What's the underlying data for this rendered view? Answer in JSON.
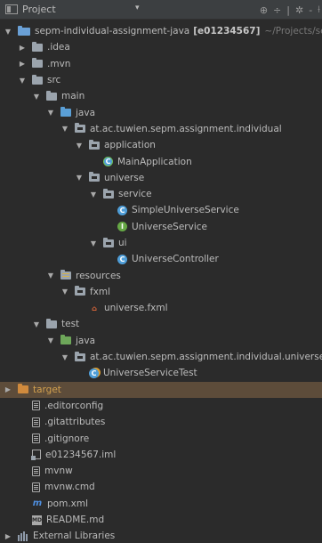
{
  "header": {
    "title": "Project",
    "dropdown": "▾",
    "tools": [
      "⊕",
      "÷",
      "|",
      "✲",
      "-",
      "⟊"
    ]
  },
  "tree": [
    {
      "depth": 0,
      "arrow": "▼",
      "icon": "module",
      "label": "sepm-individual-assignment-java",
      "bold_label": "[e01234567]",
      "path": "~/Projects/sepm",
      "name": "tree-item-root"
    },
    {
      "depth": 1,
      "arrow": "▶",
      "icon": "folder",
      "label": ".idea",
      "name": "tree-item-idea"
    },
    {
      "depth": 1,
      "arrow": "▶",
      "icon": "folder",
      "label": ".mvn",
      "name": "tree-item-mvn"
    },
    {
      "depth": 1,
      "arrow": "▼",
      "icon": "folder",
      "label": "src",
      "name": "tree-item-src"
    },
    {
      "depth": 2,
      "arrow": "▼",
      "icon": "folder",
      "label": "main",
      "name": "tree-item-main"
    },
    {
      "depth": 3,
      "arrow": "▼",
      "icon": "folder-blue",
      "label": "java",
      "name": "tree-item-main-java"
    },
    {
      "depth": 4,
      "arrow": "▼",
      "icon": "package",
      "label": "at.ac.tuwien.sepm.assignment.individual",
      "name": "tree-item-package-individual"
    },
    {
      "depth": 5,
      "arrow": "▼",
      "icon": "package",
      "label": "application",
      "name": "tree-item-application"
    },
    {
      "depth": 6,
      "arrow": "",
      "icon": "spring-class",
      "label": "MainApplication",
      "name": "tree-item-mainapplication"
    },
    {
      "depth": 5,
      "arrow": "▼",
      "icon": "package",
      "label": "universe",
      "name": "tree-item-universe"
    },
    {
      "depth": 6,
      "arrow": "▼",
      "icon": "package",
      "label": "service",
      "name": "tree-item-service"
    },
    {
      "depth": 7,
      "arrow": "",
      "icon": "class",
      "label": "SimpleUniverseService",
      "name": "tree-item-simpleuniverseservice"
    },
    {
      "depth": 7,
      "arrow": "",
      "icon": "interface",
      "label": "UniverseService",
      "name": "tree-item-universeservice"
    },
    {
      "depth": 6,
      "arrow": "▼",
      "icon": "package",
      "label": "ui",
      "name": "tree-item-ui"
    },
    {
      "depth": 7,
      "arrow": "",
      "icon": "class",
      "label": "UniverseController",
      "name": "tree-item-universecontroller"
    },
    {
      "depth": 3,
      "arrow": "▼",
      "icon": "resources",
      "label": "resources",
      "name": "tree-item-resources"
    },
    {
      "depth": 4,
      "arrow": "▼",
      "icon": "package",
      "label": "fxml",
      "name": "tree-item-fxml-folder"
    },
    {
      "depth": 5,
      "arrow": "",
      "icon": "fxml",
      "label": "universe.fxml",
      "name": "tree-item-universe-fxml"
    },
    {
      "depth": 2,
      "arrow": "▼",
      "icon": "folder",
      "label": "test",
      "name": "tree-item-test"
    },
    {
      "depth": 3,
      "arrow": "▼",
      "icon": "folder-green",
      "label": "java",
      "name": "tree-item-test-java"
    },
    {
      "depth": 4,
      "arrow": "▼",
      "icon": "package",
      "label": "at.ac.tuwien.sepm.assignment.individual.universe",
      "name": "tree-item-package-universe-test"
    },
    {
      "depth": 5,
      "arrow": "",
      "icon": "test-class",
      "label": "UniverseServiceTest",
      "name": "tree-item-universeservicetest"
    },
    {
      "depth": 0,
      "arrow": "▶",
      "icon": "folder-orange",
      "label": "target",
      "selected": true,
      "labelColor": "orange",
      "name": "tree-item-target"
    },
    {
      "depth": 1,
      "arrow": "",
      "icon": "file",
      "label": ".editorconfig",
      "name": "tree-item-editorconfig"
    },
    {
      "depth": 1,
      "arrow": "",
      "icon": "file",
      "label": ".gitattributes",
      "name": "tree-item-gitattributes"
    },
    {
      "depth": 1,
      "arrow": "",
      "icon": "file",
      "label": ".gitignore",
      "name": "tree-item-gitignore"
    },
    {
      "depth": 1,
      "arrow": "",
      "icon": "iml",
      "label": "e01234567.iml",
      "name": "tree-item-iml"
    },
    {
      "depth": 1,
      "arrow": "",
      "icon": "file",
      "label": "mvnw",
      "name": "tree-item-mvnw"
    },
    {
      "depth": 1,
      "arrow": "",
      "icon": "file",
      "label": "mvnw.cmd",
      "name": "tree-item-mvnw-cmd"
    },
    {
      "depth": 1,
      "arrow": "",
      "icon": "maven",
      "label": "pom.xml",
      "name": "tree-item-pom"
    },
    {
      "depth": 1,
      "arrow": "",
      "icon": "md",
      "label": "README.md",
      "name": "tree-item-readme"
    },
    {
      "depth": 0,
      "arrow": "▶",
      "icon": "libraries",
      "label": "External Libraries",
      "name": "tree-item-external-libraries"
    }
  ],
  "colors": {
    "background": "#2b2b2b",
    "header": "#3c3f41",
    "selection": "#5d4c3a",
    "text": "#bbbbbb"
  }
}
